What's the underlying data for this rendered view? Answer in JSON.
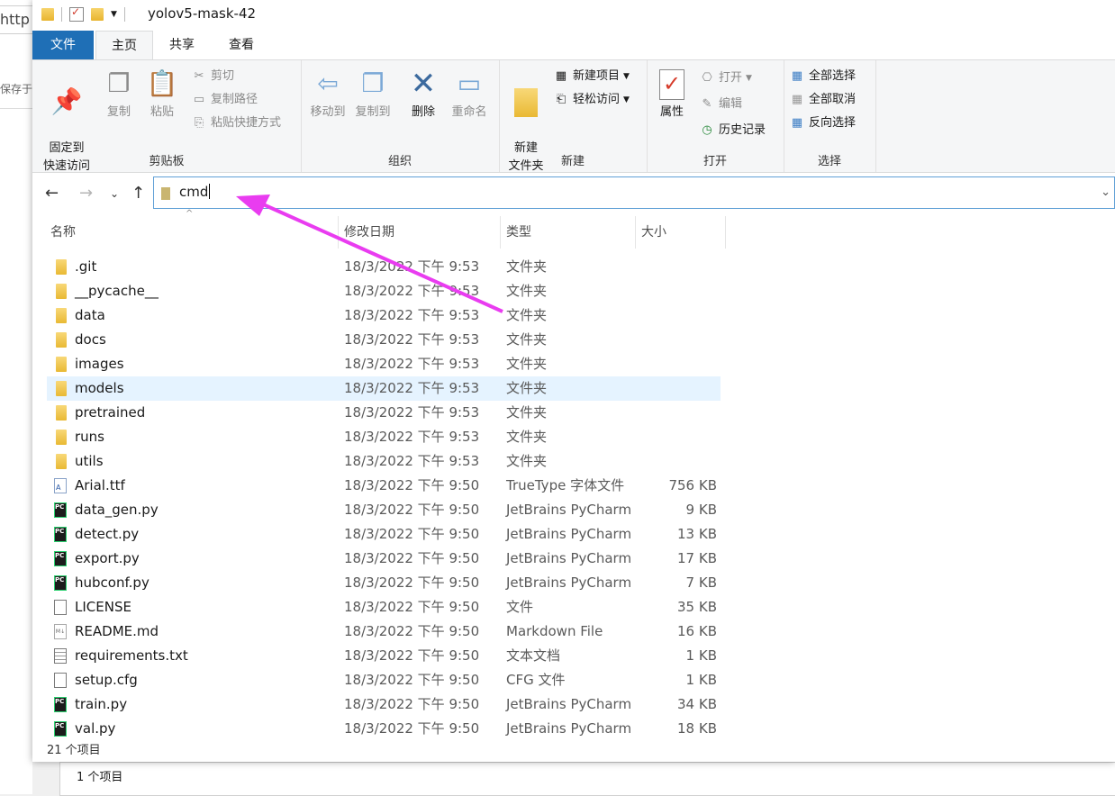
{
  "background": {
    "url_fragment": "http",
    "side_text": "保存于",
    "status_text": "1 个项目"
  },
  "window": {
    "title": "yolov5-mask-42"
  },
  "tabs": [
    {
      "label": "文件"
    },
    {
      "label": "主页"
    },
    {
      "label": "共享"
    },
    {
      "label": "查看"
    }
  ],
  "ribbon": {
    "clipboard": {
      "pin": "固定到\n快速访问",
      "copy": "复制",
      "paste": "粘贴",
      "cut": "剪切",
      "copy_path": "复制路径",
      "paste_shortcut": "粘贴快捷方式",
      "label": "剪贴板"
    },
    "organize": {
      "move_to": "移动到",
      "copy_to": "复制到",
      "delete": "删除",
      "rename": "重命名",
      "label": "组织"
    },
    "new": {
      "new_folder": "新建\n文件夹",
      "new_item": "新建项目",
      "easy_access": "轻松访问",
      "label": "新建"
    },
    "open": {
      "properties": "属性",
      "open": "打开",
      "edit": "编辑",
      "history": "历史记录",
      "label": "打开"
    },
    "select": {
      "select_all": "全部选择",
      "select_none": "全部取消",
      "invert": "反向选择",
      "label": "选择"
    }
  },
  "address": {
    "value": "cmd"
  },
  "columns": {
    "name": "名称",
    "date": "修改日期",
    "type": "类型",
    "size": "大小"
  },
  "files": [
    {
      "name": ".git",
      "date": "18/3/2022 下午 9:53",
      "type": "文件夹",
      "size": "",
      "icon": "folder-icon"
    },
    {
      "name": "__pycache__",
      "date": "18/3/2022 下午 9:53",
      "type": "文件夹",
      "size": "",
      "icon": "folder-icon"
    },
    {
      "name": "data",
      "date": "18/3/2022 下午 9:53",
      "type": "文件夹",
      "size": "",
      "icon": "folder-icon"
    },
    {
      "name": "docs",
      "date": "18/3/2022 下午 9:53",
      "type": "文件夹",
      "size": "",
      "icon": "folder-icon"
    },
    {
      "name": "images",
      "date": "18/3/2022 下午 9:53",
      "type": "文件夹",
      "size": "",
      "icon": "folder-icon"
    },
    {
      "name": "models",
      "date": "18/3/2022 下午 9:53",
      "type": "文件夹",
      "size": "",
      "icon": "folder-icon"
    },
    {
      "name": "pretrained",
      "date": "18/3/2022 下午 9:53",
      "type": "文件夹",
      "size": "",
      "icon": "folder-icon"
    },
    {
      "name": "runs",
      "date": "18/3/2022 下午 9:53",
      "type": "文件夹",
      "size": "",
      "icon": "folder-icon"
    },
    {
      "name": "utils",
      "date": "18/3/2022 下午 9:53",
      "type": "文件夹",
      "size": "",
      "icon": "folder-icon"
    },
    {
      "name": "Arial.ttf",
      "date": "18/3/2022 下午 9:50",
      "type": "TrueType 字体文件",
      "size": "756 KB",
      "icon": "font-file-icon"
    },
    {
      "name": "data_gen.py",
      "date": "18/3/2022 下午 9:50",
      "type": "JetBrains PyCharm",
      "size": "9 KB",
      "icon": "pycharm-file-icon"
    },
    {
      "name": "detect.py",
      "date": "18/3/2022 下午 9:50",
      "type": "JetBrains PyCharm",
      "size": "13 KB",
      "icon": "pycharm-file-icon"
    },
    {
      "name": "export.py",
      "date": "18/3/2022 下午 9:50",
      "type": "JetBrains PyCharm",
      "size": "17 KB",
      "icon": "pycharm-file-icon"
    },
    {
      "name": "hubconf.py",
      "date": "18/3/2022 下午 9:50",
      "type": "JetBrains PyCharm",
      "size": "7 KB",
      "icon": "pycharm-file-icon"
    },
    {
      "name": "LICENSE",
      "date": "18/3/2022 下午 9:50",
      "type": "文件",
      "size": "35 KB",
      "icon": "blank-file-icon"
    },
    {
      "name": "README.md",
      "date": "18/3/2022 下午 9:50",
      "type": "Markdown File",
      "size": "16 KB",
      "icon": "markdown-file-icon"
    },
    {
      "name": "requirements.txt",
      "date": "18/3/2022 下午 9:50",
      "type": "文本文档",
      "size": "1 KB",
      "icon": "text-file-icon"
    },
    {
      "name": "setup.cfg",
      "date": "18/3/2022 下午 9:50",
      "type": "CFG 文件",
      "size": "1 KB",
      "icon": "blank-file-icon"
    },
    {
      "name": "train.py",
      "date": "18/3/2022 下午 9:50",
      "type": "JetBrains PyCharm",
      "size": "34 KB",
      "icon": "pycharm-file-icon"
    },
    {
      "name": "val.py",
      "date": "18/3/2022 下午 9:50",
      "type": "JetBrains PyCharm",
      "size": "18 KB",
      "icon": "pycharm-file-icon"
    }
  ],
  "selected_file": "models",
  "status": {
    "count": "21 个项目"
  },
  "colors": {
    "accent": "#1f6fb6",
    "selection": "#e5f3ff",
    "annotation_arrow": "#e93cf0"
  }
}
